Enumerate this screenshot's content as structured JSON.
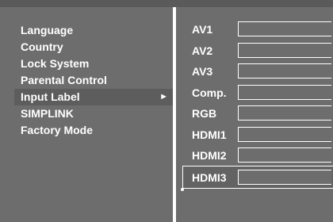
{
  "menu": {
    "items": [
      {
        "label": "Language"
      },
      {
        "label": "Country"
      },
      {
        "label": "Lock System"
      },
      {
        "label": "Parental Control"
      },
      {
        "label": "Input Label",
        "arrow": "►"
      },
      {
        "label": "SIMPLINK"
      },
      {
        "label": "Factory Mode"
      }
    ]
  },
  "input_labels": {
    "rows": [
      {
        "name": "AV1",
        "value": ""
      },
      {
        "name": "AV2",
        "value": ""
      },
      {
        "name": "AV3",
        "value": ""
      },
      {
        "name": "Comp.",
        "value": ""
      },
      {
        "name": "RGB",
        "value": ""
      },
      {
        "name": "HDMI1",
        "value": ""
      },
      {
        "name": "HDMI2",
        "value": ""
      },
      {
        "name": "HDMI3",
        "value": ""
      }
    ]
  }
}
